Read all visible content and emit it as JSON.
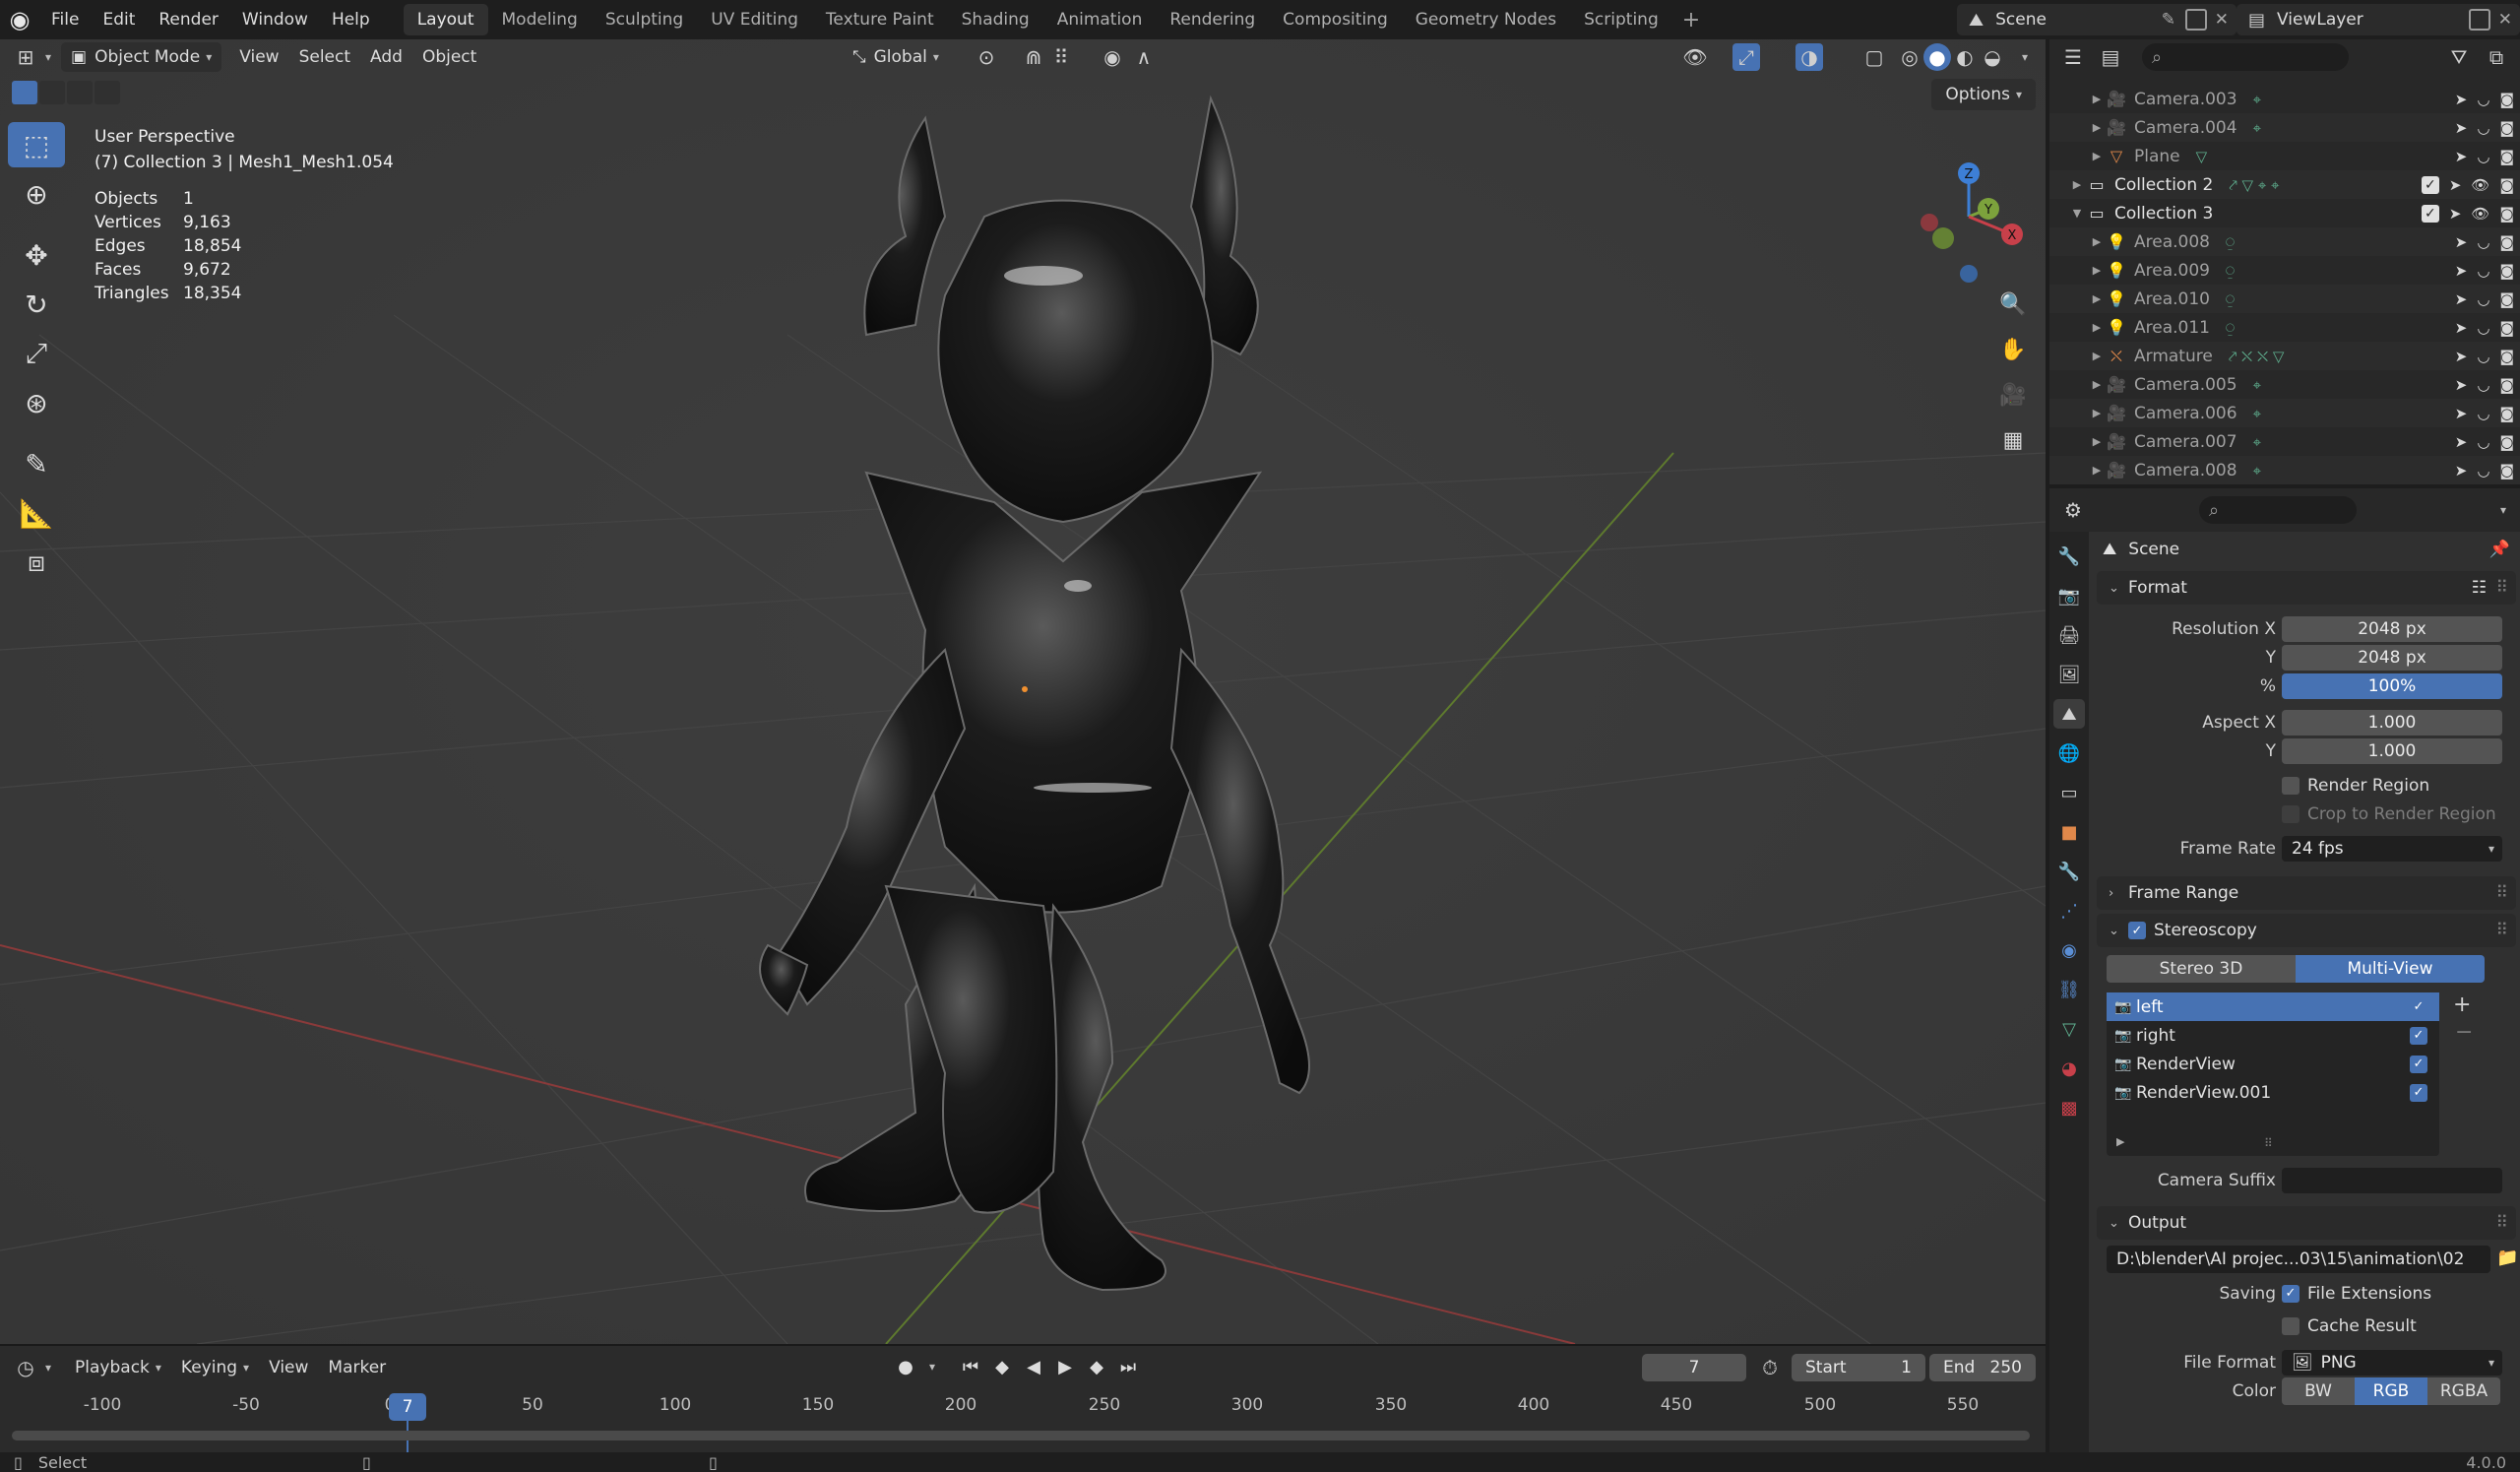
{
  "topbar": {
    "menus": [
      "File",
      "Edit",
      "Render",
      "Window",
      "Help"
    ],
    "workspaces": [
      "Layout",
      "Modeling",
      "Sculpting",
      "UV Editing",
      "Texture Paint",
      "Shading",
      "Animation",
      "Rendering",
      "Compositing",
      "Geometry Nodes",
      "Scripting"
    ],
    "active_workspace": "Layout",
    "scene_name": "Scene",
    "view_layer": "ViewLayer"
  },
  "viewport": {
    "mode": "Object Mode",
    "menus": [
      "View",
      "Select",
      "Add",
      "Object"
    ],
    "transform_orientation": "Global",
    "options_label": "Options",
    "view_name": "User Perspective",
    "collection_info": "(7) Collection 3 | Mesh1_Mesh1.054",
    "stats": [
      {
        "label": "Objects",
        "value": "1"
      },
      {
        "label": "Vertices",
        "value": "9,163"
      },
      {
        "label": "Edges",
        "value": "18,854"
      },
      {
        "label": "Faces",
        "value": "9,672"
      },
      {
        "label": "Triangles",
        "value": "18,354"
      }
    ],
    "gizmo_axes": {
      "x": "X",
      "y": "Y",
      "z": "Z"
    }
  },
  "timeline": {
    "menus": [
      "Playback",
      "Keying",
      "View",
      "Marker"
    ],
    "current_frame": "7",
    "start_label": "Start",
    "start_value": "1",
    "end_label": "End",
    "end_value": "250",
    "ruler": [
      "-100",
      "-50",
      "0",
      "50",
      "100",
      "150",
      "200",
      "250",
      "300",
      "350",
      "400",
      "450",
      "500",
      "550"
    ],
    "playhead_label": "7"
  },
  "statusbar": {
    "action": "Select",
    "version": "4.0.0"
  },
  "outliner": {
    "rows": [
      {
        "name": "Camera.003",
        "type": "object"
      },
      {
        "name": "Camera.004",
        "type": "object"
      },
      {
        "name": "Plane",
        "type": "object"
      },
      {
        "name": "Collection 2",
        "type": "collection"
      },
      {
        "name": "Collection 3",
        "type": "collection"
      },
      {
        "name": "Area.008",
        "type": "object"
      },
      {
        "name": "Area.009",
        "type": "object"
      },
      {
        "name": "Area.010",
        "type": "object"
      },
      {
        "name": "Area.011",
        "type": "object"
      },
      {
        "name": "Armature",
        "type": "object"
      },
      {
        "name": "Camera.005",
        "type": "object"
      },
      {
        "name": "Camera.006",
        "type": "object"
      },
      {
        "name": "Camera.007",
        "type": "object"
      },
      {
        "name": "Camera.008",
        "type": "object"
      }
    ]
  },
  "properties": {
    "context": "Scene",
    "format": {
      "title": "Format",
      "resolution_x_label": "Resolution X",
      "resolution_x": "2048 px",
      "resolution_y_label": "Y",
      "resolution_y": "2048 px",
      "percent_label": "%",
      "percent": "100%",
      "aspect_x_label": "Aspect X",
      "aspect_x": "1.000",
      "aspect_y_label": "Y",
      "aspect_y": "1.000",
      "render_region": "Render Region",
      "crop_region": "Crop to Render Region",
      "frame_rate_label": "Frame Rate",
      "frame_rate": "24 fps"
    },
    "frame_range": {
      "title": "Frame Range"
    },
    "stereoscopy": {
      "title": "Stereoscopy",
      "mode_stereo": "Stereo 3D",
      "mode_multi": "Multi-View",
      "views": [
        "left",
        "right",
        "RenderView",
        "RenderView.001"
      ],
      "camera_suffix_label": "Camera Suffix",
      "camera_suffix": ""
    },
    "output": {
      "title": "Output",
      "path": "D:\\blender\\AI projec...03\\15\\animation\\02",
      "saving_label": "Saving",
      "file_extensions": "File Extensions",
      "cache_result": "Cache Result",
      "file_format_label": "File Format",
      "file_format": "PNG",
      "color_label": "Color",
      "color_modes": [
        "BW",
        "RGB",
        "RGBA"
      ],
      "color_active": "RGB"
    }
  },
  "colors": {
    "accent": "#4772b3",
    "x_axis": "#c8404a",
    "y_axis": "#7ca23c",
    "z_axis": "#3d7fd6",
    "object_icon": "#e0884a",
    "data_icon": "#5fb08f"
  }
}
